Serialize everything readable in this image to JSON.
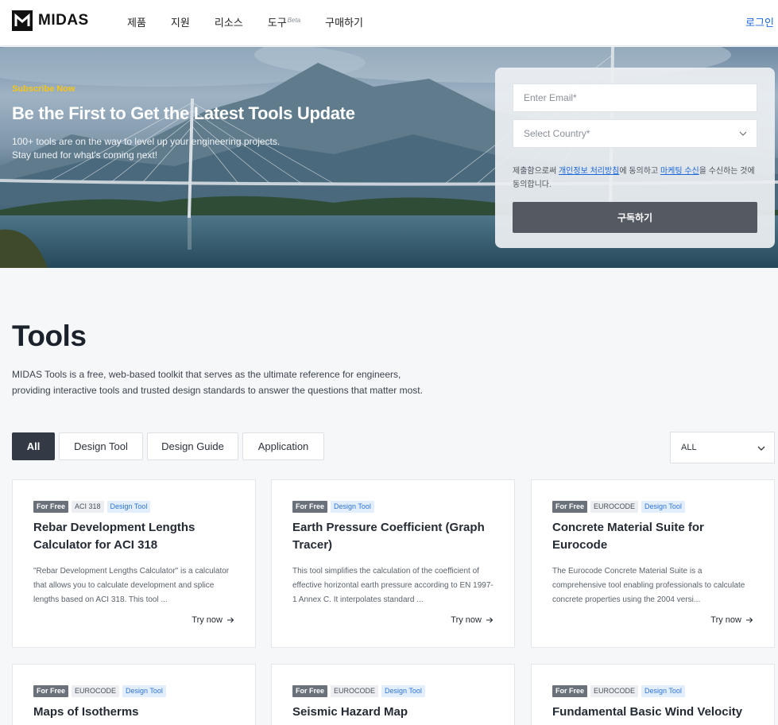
{
  "header": {
    "brand": "MIDAS",
    "nav": [
      {
        "label": "제품"
      },
      {
        "label": "지원"
      },
      {
        "label": "리소스"
      },
      {
        "label": "도구",
        "badge": "Beta"
      },
      {
        "label": "구매하기"
      }
    ],
    "login": "로그인"
  },
  "hero": {
    "tag": "Subscribe Now",
    "title": "Be the First to Get the Latest Tools Update",
    "desc_line1": "100+ tools are on the way to level up your engineering projects.",
    "desc_line2": "Stay tuned for what's coming next!"
  },
  "subscribe": {
    "email_placeholder": "Enter Email*",
    "country_placeholder": "Select Country*",
    "consent_pre": "제출함으로써 ",
    "consent_link1": "개인정보 처리방침",
    "consent_mid": "에 동의하고 ",
    "consent_link2": "마케팅 수신",
    "consent_post": "을 수신하는 것에 동의합니다.",
    "button": "구독하기"
  },
  "tools": {
    "title": "Tools",
    "desc_line1": "MIDAS Tools is a free, web-based toolkit that serves as the ultimate reference for engineers,",
    "desc_line2": "providing interactive tools and trusted design standards to answer the questions that matter most.",
    "filters": [
      "All",
      "Design Tool",
      "Design Guide",
      "Application"
    ],
    "sort_value": "ALL",
    "try_label": "Try now"
  },
  "cards": [
    {
      "free": "For Free",
      "std": "ACI 318",
      "type": "Design Tool",
      "title": "Rebar Development Lengths Calculator for ACI 318",
      "desc": "\"Rebar Development Lengths Calculator\" is a calculator that allows you to calculate development and splice lengths based on ACI 318. This tool ..."
    },
    {
      "free": "For Free",
      "std": "",
      "type": "Design Tool",
      "title": "Earth Pressure Coefficient (Graph Tracer)",
      "desc": "This tool simplifies the calculation of the coefficient of effective horizontal earth pressure according to EN 1997-1 Annex C. It interpolates standard ..."
    },
    {
      "free": "For Free",
      "std": "EUROCODE",
      "type": "Design Tool",
      "title": "Concrete Material Suite for Eurocode",
      "desc": "The Eurocode Concrete Material Suite is a comprehensive tool enabling professionals to calculate concrete properties using the 2004 versi..."
    },
    {
      "free": "For Free",
      "std": "EUROCODE",
      "type": "Design Tool",
      "title": "Maps of Isotherms",
      "desc": ""
    },
    {
      "free": "For Free",
      "std": "EUROCODE",
      "type": "Design Tool",
      "title": "Seismic Hazard Map",
      "desc": ""
    },
    {
      "free": "For Free",
      "std": "EUROCODE",
      "type": "Design Tool",
      "title": "Fundamental Basic Wind Velocity M...",
      "desc": ""
    }
  ]
}
